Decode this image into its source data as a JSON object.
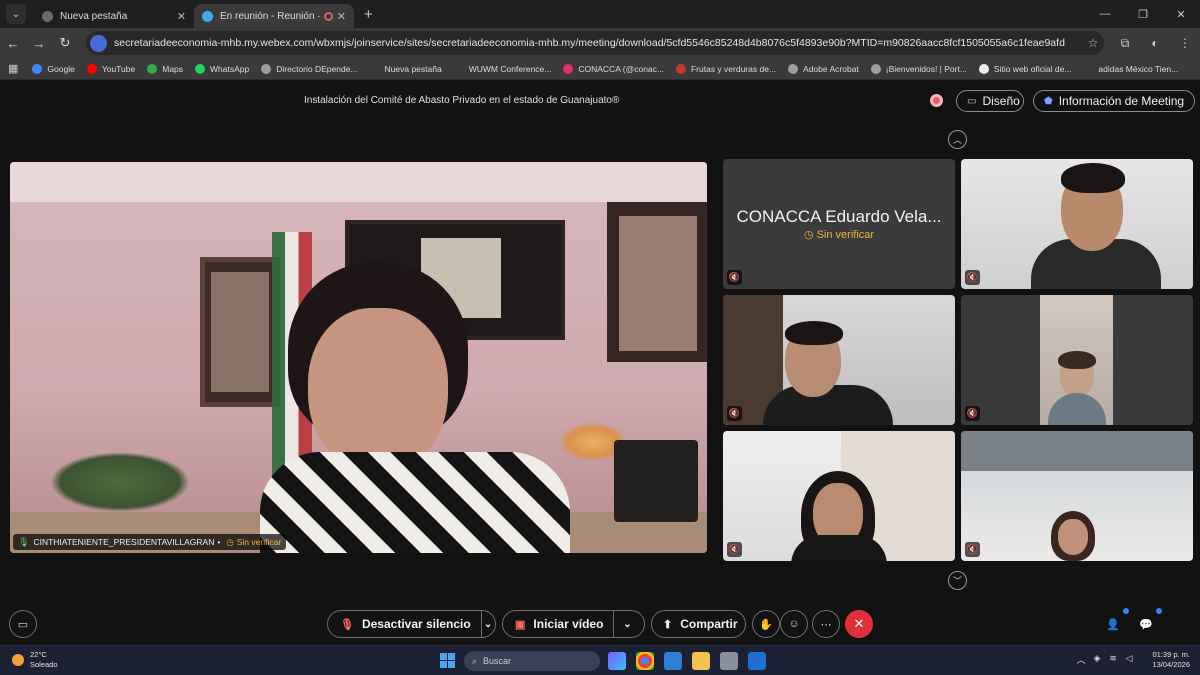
{
  "browser": {
    "tabs": [
      {
        "label": "Nueva pestaña",
        "active": false
      },
      {
        "label": "En reunión - Reunión · Webex",
        "active": true
      }
    ],
    "url": "secretariadeeconomia-mhb.my.webex.com/wbxmjs/joinservice/sites/secretariadeeconomia-mhb.my/meeting/download/5cfd5546c85248d4b8076c5f4893e90b?MTID=m90826aacc8fcf1505055a6c1feae9afd",
    "bookmarks": [
      {
        "label": "Google",
        "color": "#4285f4"
      },
      {
        "label": "YouTube",
        "color": "#ff0000"
      },
      {
        "label": "Maps",
        "color": "#34a853"
      },
      {
        "label": "WhatsApp",
        "color": "#25d366"
      },
      {
        "label": "Directorio DEpende...",
        "color": "#9e9e9e"
      },
      {
        "label": "Nueva pestaña",
        "color": "#3a3a3a"
      },
      {
        "label": "WUWM Conference...",
        "color": "#3a3a3a"
      },
      {
        "label": "CONACCA (@conac...",
        "color": "#e1306c"
      },
      {
        "label": "Frutas y verduras de...",
        "color": "#c0392b"
      },
      {
        "label": "Adobe Acrobat",
        "color": "#9e9e9e"
      },
      {
        "label": "¡Bienvenidos! | Port...",
        "color": "#9e9e9e"
      },
      {
        "label": "Sitio web oficial de...",
        "color": "#f0f0f0"
      },
      {
        "label": "adidas México Tien...",
        "color": "#3a3a3a"
      }
    ]
  },
  "meeting": {
    "title": "Instalación del Comité de Abasto Privado en el estado de Guanajuato®",
    "design_label": "Diseño",
    "info_label": "Información de Meeting",
    "main_speaker": {
      "name": "CINTHIATENIENTE_PRESIDENTAVILLAGRAN",
      "separator": "•",
      "status": "Sin verificar"
    },
    "tiles": [
      {
        "name": "CONACCA Eduardo Vela...",
        "status": "Sin verificar",
        "muted": true
      },
      {
        "muted": true
      },
      {
        "muted": true
      },
      {
        "muted": true
      },
      {
        "muted": true
      },
      {
        "muted": true
      }
    ],
    "controls": {
      "mute_label": "Desactivar silencio",
      "video_label": "Iniciar vídeo",
      "share_label": "Compartir"
    },
    "accent": "#e0313b"
  },
  "taskbar": {
    "temperature": "22°C",
    "weather": "Soleado",
    "search_placeholder": "Buscar",
    "time": "01:39 p. m.",
    "date": "13/04/2026"
  }
}
